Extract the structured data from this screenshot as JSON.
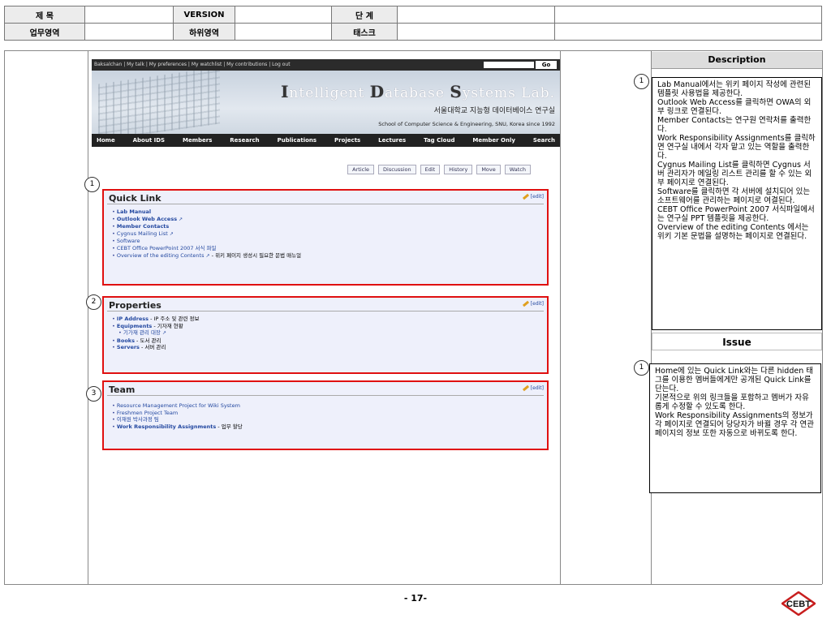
{
  "header": {
    "title_label": "제 목",
    "version_label": "VERSION",
    "stage_label": "단 계",
    "biz_area_label": "업무영역",
    "sub_area_label": "하위영역",
    "task_label": "태스크"
  },
  "wiki": {
    "user_bar": "Baksalchan | My talk | My preferences | My watchlist | My contributions | Log out",
    "go_label": "Go",
    "lab_title_1": "I",
    "lab_title_2": "ntelligent ",
    "lab_title_3": "D",
    "lab_title_4": "atabase ",
    "lab_title_5": "S",
    "lab_title_6": "ystems Lab.",
    "lab_korean": "서울대학교 지능형 데이터베이스 연구실",
    "lab_school": "School of Computer Science & Engineering, SNU, Korea since 1992",
    "nav": [
      "Home",
      "About IDS",
      "Members",
      "Research",
      "Publications",
      "Projects",
      "Lectures",
      "Tag Cloud",
      "Member Only",
      "Search"
    ],
    "tabs": [
      "Article",
      "Discussion",
      "Edit",
      "History",
      "Move",
      "Watch"
    ],
    "edit_label": "[edit]",
    "quick_link": {
      "title": "Quick Link",
      "items": {
        "lab_manual": "Lab Manual",
        "owa": "Outlook Web Access",
        "contacts": "Member Contacts",
        "cygnus": "Cygnus Mailing List",
        "software": "Software",
        "cebt_office": "CEBT Office PowerPoint 2007 서식 파일",
        "overview": "Overview of the editing Contents",
        "overview_desc": " - 위키 페이지 생성시 필요한 문법 매뉴얼"
      }
    },
    "properties": {
      "title": "Properties",
      "ip": "IP Address",
      "ip_desc": " - IP 주소 및 관련 정보",
      "equip": "Equipments",
      "equip_desc": " - 기자재 현황",
      "equip_sub": "기가재 관리 대장",
      "books": "Books",
      "books_desc": " - 도서 관리",
      "servers": "Servers",
      "servers_desc": " - 서버 관리"
    },
    "team": {
      "title": "Team",
      "item1": "Resource Management Project for Wiki System",
      "item2": "Freshmen Project Team",
      "item3": "이재원 박사과정 팀",
      "item4": "Work Responsibility Assignments",
      "item4_desc": " - 업무 할당"
    },
    "callouts": [
      "1",
      "2",
      "3"
    ]
  },
  "description": {
    "title": "Description",
    "marker": "1",
    "text": "Lab Manual에서는 위키 페이지 작성에 관련된 템플릿 사용법을 제공한다.\nOutlook Web Access를 클릭하면 OWA의 외부 링크로 연결된다.\nMember Contacts는 연구원 연락처를 출력한다.\nWork Responsibility Assignments를 클릭하면 연구실 내에서 각자 맡고 있는 역할을 출력한다.\nCygnus Mailing List를 클릭하면 Cygnus 서버 관리자가 메일링 리스트 관리를 할 수 있는 외부 페이지로 연결된다.\nSoftware를 클릭하면 각 서버에 설치되어 있는 소프트웨어를 관리하는 페이지로 여결된다.\nCEBT Office PowerPoint 2007 서식파일에서는 연구실 PPT 템플릿을 제공한다.\nOverview of the editing Contents 에서는 위키 기본 문법을 설명하는 페이지로 연결된다."
  },
  "issue": {
    "title": "Issue",
    "marker": "1",
    "text": "Home에 있는 Quick Link와는 다른 hidden 태그를 이용한 멤버들에게만 공개된 Quick Link를 단는다.\n기본적으로 위의 링크들을 포함하고 멤버가 자유롭게 수정할 수 있도록 한다.\nWork Responsibility Assignments의 정보가 각 페이지로 연결되어 당당자가 바뀔 경우 각 연관 페이지의 정보 또한 자동으로 바뀌도록 한다."
  },
  "footer": {
    "page_number": "- 17-",
    "logo_text": "CEBT"
  },
  "colors": {
    "highlight_border": "#e01010",
    "section_bg": "#eef0fb",
    "link": "#2348a0"
  }
}
